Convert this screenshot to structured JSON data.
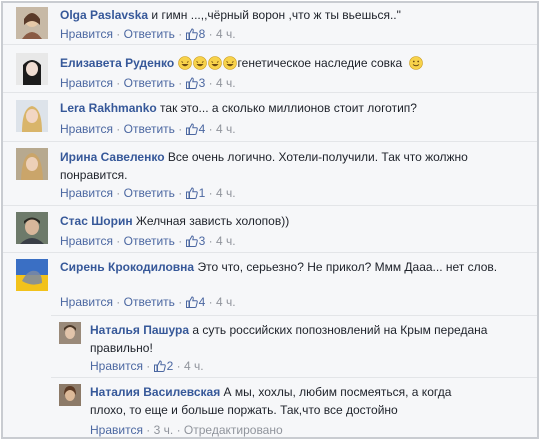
{
  "actions": {
    "like": "Нравится",
    "reply": "Ответить",
    "edited": "Отредактировано",
    "dot": "·"
  },
  "comments": [
    {
      "author": "Olga Paslavska",
      "text": "и гимн ...,,чёрный ворон ,что ж ты вьешься..\"",
      "likes": "8",
      "time": "4 ч."
    },
    {
      "author": "Елизавета Руденко",
      "text": "генетическое наследие совка",
      "likes": "3",
      "time": "4 ч."
    },
    {
      "author": "Lera Rakhmanko",
      "text": "так это... а сколько миллионов стоит логотип?",
      "likes": "4",
      "time": "4 ч."
    },
    {
      "author": "Ирина Савеленко",
      "text": "Все очень логично. Хотели-получили. Так что жолжно понравится.",
      "likes": "1",
      "time": "4 ч."
    },
    {
      "author": "Стас Шорин",
      "text": "Желчная зависть холопов))",
      "likes": "3",
      "time": "4 ч."
    },
    {
      "author": "Сирень Крокодиловна",
      "text": "Это что, серьезно? Не прикол? Ммм Дааа... нет слов.",
      "likes": "4",
      "time": "4 ч."
    },
    {
      "author": "Наталья Пашура",
      "text": "а суть российских попозновлений на Крым передана правильно!",
      "likes": "2",
      "time": "4 ч."
    },
    {
      "author": "Наталия Василевская",
      "text": "А мы, хохлы, любим посмеяться, а когда плохо, то еще и больше поржать. Так,что все достойно",
      "time": "3 ч."
    }
  ]
}
